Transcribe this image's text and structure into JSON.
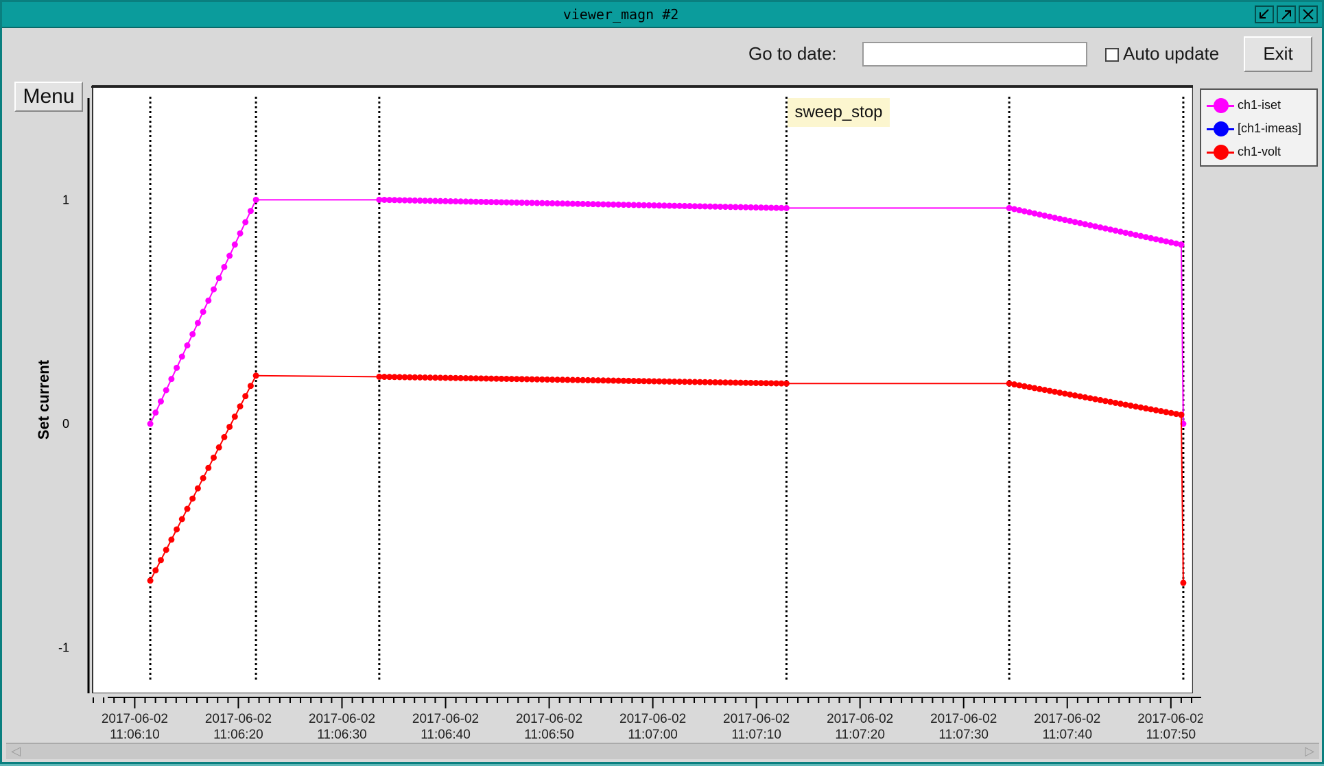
{
  "window": {
    "title": "viewer_magn #2"
  },
  "toolbar": {
    "go_to_date_label": "Go to date:",
    "date_value": "",
    "auto_update_label": "Auto update",
    "auto_update_checked": false,
    "exit_label": "Exit",
    "menu_label": "Menu"
  },
  "annotation": {
    "label": "sweep_stop"
  },
  "legend": {
    "items": [
      {
        "label": "ch1-iset",
        "color": "#ff00ff"
      },
      {
        "label": "[ch1-imeas]",
        "color": "#0000ff"
      },
      {
        "label": "ch1-volt",
        "color": "#ff0000"
      }
    ]
  },
  "chart_data": {
    "type": "line",
    "ylabel": "Set current",
    "ylim": [
      -1.2,
      1.5
    ],
    "yticks": [
      -1,
      0,
      1
    ],
    "xlim": [
      "2017-06-02 11:06:06",
      "2017-06-02 11:07:52"
    ],
    "xticks": [
      "2017-06-02 11:06:10",
      "2017-06-02 11:06:20",
      "2017-06-02 11:06:30",
      "2017-06-02 11:06:40",
      "2017-06-02 11:06:50",
      "2017-06-02 11:07:00",
      "2017-06-02 11:07:10",
      "2017-06-02 11:07:20",
      "2017-06-02 11:07:30",
      "2017-06-02 11:07:40",
      "2017-06-02 11:07:50"
    ],
    "vertical_markers": [
      "2017-06-02 11:06:11.5",
      "2017-06-02 11:06:21.7",
      "2017-06-02 11:06:33.6",
      "2017-06-02 11:07:12.9",
      "2017-06-02 11:07:34.4",
      "2017-06-02 11:07:51.2"
    ],
    "annotation_at": "2017-06-02 11:07:12.9",
    "series": [
      {
        "name": "ch1-iset",
        "color": "#ff00ff",
        "segments": [
          {
            "from": [
              "2017-06-02 11:06:11.5",
              0.0
            ],
            "to": [
              "2017-06-02 11:06:21.7",
              1.0
            ],
            "points": 20
          },
          {
            "from": [
              "2017-06-02 11:06:21.7",
              1.0
            ],
            "to": [
              "2017-06-02 11:06:33.6",
              1.0
            ],
            "points": 0
          },
          {
            "from": [
              "2017-06-02 11:06:33.6",
              1.0
            ],
            "to": [
              "2017-06-02 11:07:12.9",
              0.963
            ],
            "points": 80
          },
          {
            "from": [
              "2017-06-02 11:07:12.9",
              0.963
            ],
            "to": [
              "2017-06-02 11:07:34.4",
              0.963
            ],
            "points": 0
          },
          {
            "from": [
              "2017-06-02 11:07:34.4",
              0.963
            ],
            "to": [
              "2017-06-02 11:07:51.0",
              0.8
            ],
            "points": 34
          },
          {
            "from": [
              "2017-06-02 11:07:51.0",
              0.8
            ],
            "to": [
              "2017-06-02 11:07:51.2",
              0.0
            ],
            "points": 1
          }
        ]
      },
      {
        "name": "ch1-volt",
        "color": "#ff0000",
        "segments": [
          {
            "from": [
              "2017-06-02 11:06:11.5",
              -0.7
            ],
            "to": [
              "2017-06-02 11:06:21.7",
              0.215
            ],
            "points": 20
          },
          {
            "from": [
              "2017-06-02 11:06:21.7",
              0.215
            ],
            "to": [
              "2017-06-02 11:06:33.6",
              0.21
            ],
            "points": 0
          },
          {
            "from": [
              "2017-06-02 11:06:33.6",
              0.21
            ],
            "to": [
              "2017-06-02 11:07:12.9",
              0.18
            ],
            "points": 80
          },
          {
            "from": [
              "2017-06-02 11:07:12.9",
              0.18
            ],
            "to": [
              "2017-06-02 11:07:34.4",
              0.18
            ],
            "points": 0
          },
          {
            "from": [
              "2017-06-02 11:07:34.4",
              0.18
            ],
            "to": [
              "2017-06-02 11:07:51.0",
              0.04
            ],
            "points": 34
          },
          {
            "from": [
              "2017-06-02 11:07:51.0",
              0.04
            ],
            "to": [
              "2017-06-02 11:07:51.2",
              -0.71
            ],
            "points": 1
          }
        ]
      }
    ]
  }
}
